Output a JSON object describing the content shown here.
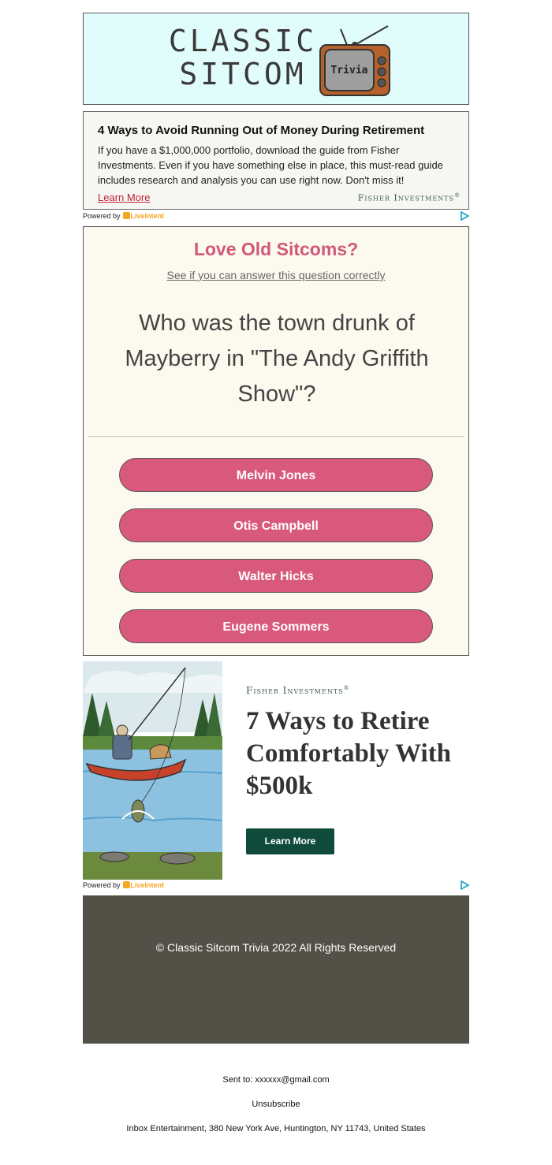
{
  "header": {
    "logo_line1": "CLASSIC",
    "logo_line2": "SITCOM",
    "tv_label": "Trivia"
  },
  "ad_top": {
    "title": "4 Ways to Avoid Running Out of Money During Retirement",
    "body": "If you have a $1,000,000 portfolio, download the guide from Fisher Investments. Even if you have something else in place, this must-read guide includes research and analysis you can use right now. Don't miss it!",
    "link": "Learn More",
    "brand": "Fisher Investments",
    "brand_mark": "®"
  },
  "powered_by": {
    "label": "Powered by",
    "brand": "LiveIntent"
  },
  "quiz": {
    "title": "Love Old Sitcoms?",
    "subtitle": "See if you can answer this question correctly",
    "question": "Who was the town drunk of Mayberry in \"The Andy Griffith Show\"?",
    "answers": [
      "Melvin Jones",
      "Otis Campbell",
      "Walter Hicks",
      "Eugene Sommers"
    ]
  },
  "ad_bottom": {
    "brand": "Fisher Investments",
    "brand_mark": "®",
    "headline": "7 Ways to Retire Comfortably With $500k",
    "button": "Learn More"
  },
  "footer": {
    "copyright": "© Classic Sitcom Trivia 2022 All Rights Reserved",
    "sent_to_label": "Sent to:",
    "sent_to_email": "xxxxxx@gmail.com",
    "unsubscribe": "Unsubscribe",
    "address": "Inbox Entertainment, 380 New York Ave, Huntington, NY 11743, United States"
  },
  "colors": {
    "header_bg": "#e1fdfb",
    "quiz_bg": "#fcf9ee",
    "accent_pink": "#d9597c",
    "fisher_green": "#0f4a3b",
    "footer_bg": "#535047"
  }
}
